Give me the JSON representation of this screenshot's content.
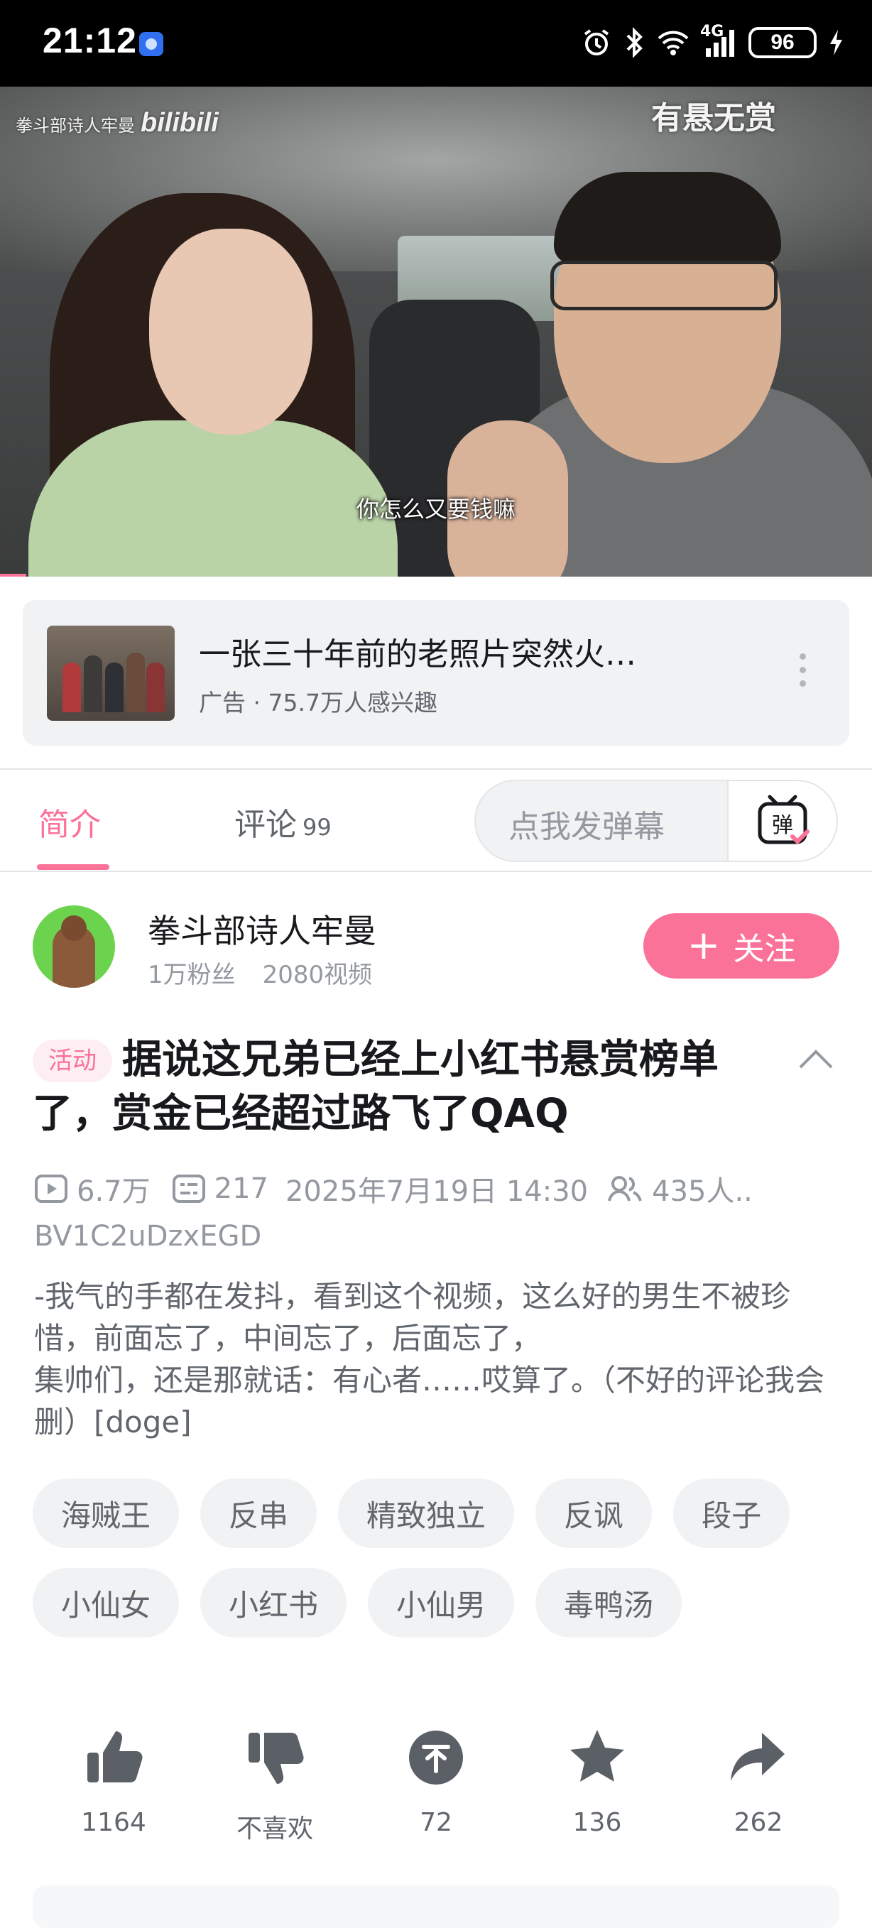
{
  "status_bar": {
    "time": "21:12",
    "network": "4G",
    "battery": "96"
  },
  "video": {
    "watermark_author": "拳斗部诗人牢曼",
    "watermark_brand": "bilibili",
    "overlay_title": "有悬无赏",
    "subtitle": "你怎么又要钱嘛",
    "progress": 0.03
  },
  "ad": {
    "title": "一张三十年前的老照片突然火…",
    "meta": "广告 · 75.7万人感兴趣"
  },
  "tabs": {
    "intro": "简介",
    "comments": "评论",
    "comments_count": "99",
    "danmaku_placeholder": "点我发弹幕",
    "danmaku_icon_text": "弹"
  },
  "uploader": {
    "name": "拳斗部诗人牢曼",
    "followers": "1万粉丝",
    "videos": "2080视频",
    "follow_label": "关注"
  },
  "video_info": {
    "badge": "活动",
    "title": "据说这兄弟已经上小红书悬赏榜单了，赏金已经超过路飞了QAQ",
    "views": "6.7万",
    "danmaku": "217",
    "date": "2025年7月19日 14:30",
    "watching": "435人..",
    "bvid": "BV1C2uDzxEGD",
    "description": "-我气的手都在发抖，看到这个视频，这么好的男生不被珍惜，前面忘了，中间忘了，后面忘了，\n集帅们，还是那就话：有心者……哎算了。（不好的评论我会删）[doge]"
  },
  "tags": {
    "row1": [
      "海贼王",
      "反串",
      "精致独立",
      "反讽",
      "段子"
    ],
    "row2": [
      "小仙女",
      "小红书",
      "小仙男",
      "毒鸭汤"
    ]
  },
  "actions": {
    "like": "1164",
    "dislike": "不喜欢",
    "coin": "72",
    "favorite": "136",
    "share": "262"
  },
  "colors": {
    "accent": "#fb7299",
    "text_secondary": "#61666d",
    "text_muted": "#9499a0",
    "chip_bg": "#f1f2f3",
    "icon_gray": "#5b5f66"
  }
}
